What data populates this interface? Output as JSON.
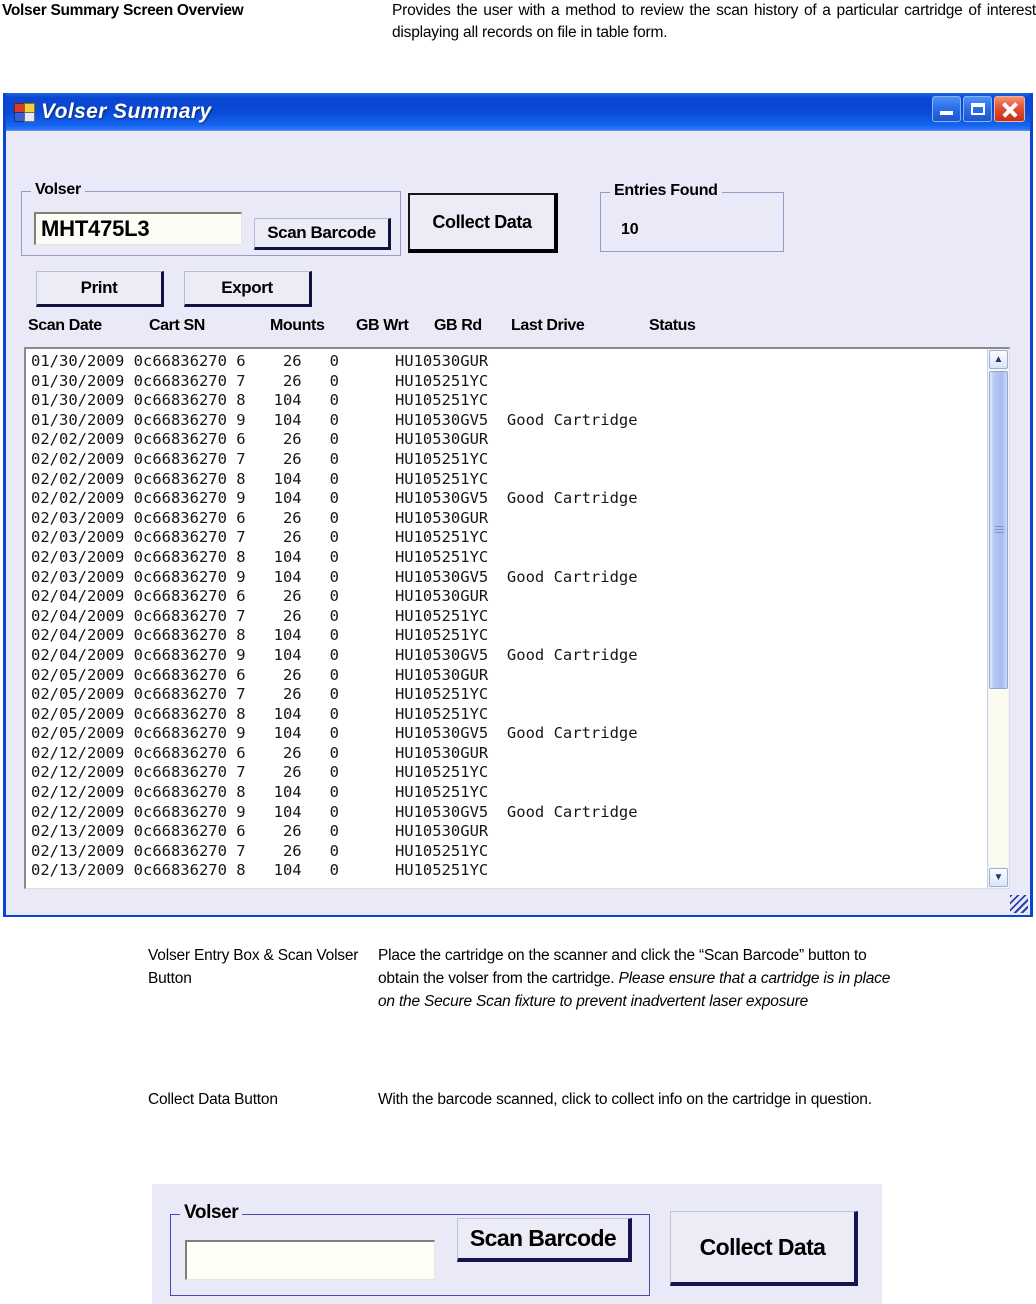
{
  "top_doc": {
    "term": "Volser Summary Screen Overview",
    "definition": "Provides the user with a method to review the scan history of a particular cartridge of interest displaying all records on file in table form."
  },
  "window": {
    "title": "Volser Summary",
    "icon": "form-icon",
    "minimize_label": "Minimize",
    "maximize_label": "Maximize",
    "close_label": "Close"
  },
  "volser_group": {
    "legend": "Volser",
    "input_value": "MHT475L3",
    "input_placeholder": "",
    "scan_button": "Scan Barcode"
  },
  "collect_data_button": "Collect Data",
  "entries_group": {
    "legend": "Entries Found",
    "value": "10"
  },
  "toolbar": {
    "print_label": "Print",
    "export_label": "Export"
  },
  "table": {
    "columns": [
      "Scan Date",
      "Cart SN",
      "Mounts",
      "GB Wrt",
      "GB Rd",
      "Last Drive",
      "Status"
    ],
    "rows": [
      {
        "scan_date": "01/30/2009",
        "cart_sn": "0c66836270",
        "mounts": "6",
        "gb_wrt": "26",
        "gb_rd": "0",
        "last_drive": "HU10530GUR",
        "status": ""
      },
      {
        "scan_date": "01/30/2009",
        "cart_sn": "0c66836270",
        "mounts": "7",
        "gb_wrt": "26",
        "gb_rd": "0",
        "last_drive": "HU105251YC",
        "status": ""
      },
      {
        "scan_date": "01/30/2009",
        "cart_sn": "0c66836270",
        "mounts": "8",
        "gb_wrt": "104",
        "gb_rd": "0",
        "last_drive": "HU105251YC",
        "status": ""
      },
      {
        "scan_date": "01/30/2009",
        "cart_sn": "0c66836270",
        "mounts": "9",
        "gb_wrt": "104",
        "gb_rd": "0",
        "last_drive": "HU10530GV5",
        "status": "Good Cartridge"
      },
      {
        "scan_date": "02/02/2009",
        "cart_sn": "0c66836270",
        "mounts": "6",
        "gb_wrt": "26",
        "gb_rd": "0",
        "last_drive": "HU10530GUR",
        "status": ""
      },
      {
        "scan_date": "02/02/2009",
        "cart_sn": "0c66836270",
        "mounts": "7",
        "gb_wrt": "26",
        "gb_rd": "0",
        "last_drive": "HU105251YC",
        "status": ""
      },
      {
        "scan_date": "02/02/2009",
        "cart_sn": "0c66836270",
        "mounts": "8",
        "gb_wrt": "104",
        "gb_rd": "0",
        "last_drive": "HU105251YC",
        "status": ""
      },
      {
        "scan_date": "02/02/2009",
        "cart_sn": "0c66836270",
        "mounts": "9",
        "gb_wrt": "104",
        "gb_rd": "0",
        "last_drive": "HU10530GV5",
        "status": "Good Cartridge"
      },
      {
        "scan_date": "02/03/2009",
        "cart_sn": "0c66836270",
        "mounts": "6",
        "gb_wrt": "26",
        "gb_rd": "0",
        "last_drive": "HU10530GUR",
        "status": ""
      },
      {
        "scan_date": "02/03/2009",
        "cart_sn": "0c66836270",
        "mounts": "7",
        "gb_wrt": "26",
        "gb_rd": "0",
        "last_drive": "HU105251YC",
        "status": ""
      },
      {
        "scan_date": "02/03/2009",
        "cart_sn": "0c66836270",
        "mounts": "8",
        "gb_wrt": "104",
        "gb_rd": "0",
        "last_drive": "HU105251YC",
        "status": ""
      },
      {
        "scan_date": "02/03/2009",
        "cart_sn": "0c66836270",
        "mounts": "9",
        "gb_wrt": "104",
        "gb_rd": "0",
        "last_drive": "HU10530GV5",
        "status": "Good Cartridge"
      },
      {
        "scan_date": "02/04/2009",
        "cart_sn": "0c66836270",
        "mounts": "6",
        "gb_wrt": "26",
        "gb_rd": "0",
        "last_drive": "HU10530GUR",
        "status": ""
      },
      {
        "scan_date": "02/04/2009",
        "cart_sn": "0c66836270",
        "mounts": "7",
        "gb_wrt": "26",
        "gb_rd": "0",
        "last_drive": "HU105251YC",
        "status": ""
      },
      {
        "scan_date": "02/04/2009",
        "cart_sn": "0c66836270",
        "mounts": "8",
        "gb_wrt": "104",
        "gb_rd": "0",
        "last_drive": "HU105251YC",
        "status": ""
      },
      {
        "scan_date": "02/04/2009",
        "cart_sn": "0c66836270",
        "mounts": "9",
        "gb_wrt": "104",
        "gb_rd": "0",
        "last_drive": "HU10530GV5",
        "status": "Good Cartridge"
      },
      {
        "scan_date": "02/05/2009",
        "cart_sn": "0c66836270",
        "mounts": "6",
        "gb_wrt": "26",
        "gb_rd": "0",
        "last_drive": "HU10530GUR",
        "status": ""
      },
      {
        "scan_date": "02/05/2009",
        "cart_sn": "0c66836270",
        "mounts": "7",
        "gb_wrt": "26",
        "gb_rd": "0",
        "last_drive": "HU105251YC",
        "status": ""
      },
      {
        "scan_date": "02/05/2009",
        "cart_sn": "0c66836270",
        "mounts": "8",
        "gb_wrt": "104",
        "gb_rd": "0",
        "last_drive": "HU105251YC",
        "status": ""
      },
      {
        "scan_date": "02/05/2009",
        "cart_sn": "0c66836270",
        "mounts": "9",
        "gb_wrt": "104",
        "gb_rd": "0",
        "last_drive": "HU10530GV5",
        "status": "Good Cartridge"
      },
      {
        "scan_date": "02/12/2009",
        "cart_sn": "0c66836270",
        "mounts": "6",
        "gb_wrt": "26",
        "gb_rd": "0",
        "last_drive": "HU10530GUR",
        "status": ""
      },
      {
        "scan_date": "02/12/2009",
        "cart_sn": "0c66836270",
        "mounts": "7",
        "gb_wrt": "26",
        "gb_rd": "0",
        "last_drive": "HU105251YC",
        "status": ""
      },
      {
        "scan_date": "02/12/2009",
        "cart_sn": "0c66836270",
        "mounts": "8",
        "gb_wrt": "104",
        "gb_rd": "0",
        "last_drive": "HU105251YC",
        "status": ""
      },
      {
        "scan_date": "02/12/2009",
        "cart_sn": "0c66836270",
        "mounts": "9",
        "gb_wrt": "104",
        "gb_rd": "0",
        "last_drive": "HU10530GV5",
        "status": "Good Cartridge"
      },
      {
        "scan_date": "02/13/2009",
        "cart_sn": "0c66836270",
        "mounts": "6",
        "gb_wrt": "26",
        "gb_rd": "0",
        "last_drive": "HU10530GUR",
        "status": ""
      },
      {
        "scan_date": "02/13/2009",
        "cart_sn": "0c66836270",
        "mounts": "7",
        "gb_wrt": "26",
        "gb_rd": "0",
        "last_drive": "HU105251YC",
        "status": ""
      },
      {
        "scan_date": "02/13/2009",
        "cart_sn": "0c66836270",
        "mounts": "8",
        "gb_wrt": "104",
        "gb_rd": "0",
        "last_drive": "HU105251YC",
        "status": ""
      }
    ]
  },
  "scrollbar": {
    "up_arrow": "▲",
    "down_arrow": "▼"
  },
  "descriptions": [
    {
      "term": "Volser Entry Box & Scan Volser Button",
      "definition_normal": "Place the cartridge on the scanner and click the “Scan Barcode” button to obtain the volser from the cartridge. ",
      "definition_italic": "Please ensure that a cartridge is in place on the Secure Scan fixture to prevent inadvertent laser exposure"
    },
    {
      "term": "Collect Data Button",
      "definition_normal": "With the barcode scanned, click to collect info on the cartridge in question.",
      "definition_italic": ""
    }
  ],
  "bottom_figure": {
    "legend": "Volser",
    "input_value": "",
    "scan_button": "Scan Barcode",
    "collect_button": "Collect Data"
  },
  "colors": {
    "titlebar_blue": "#0a46d2",
    "client_bg": "#e9e9f7",
    "close_red": "#e4553a",
    "list_bg": "#ffffff"
  }
}
